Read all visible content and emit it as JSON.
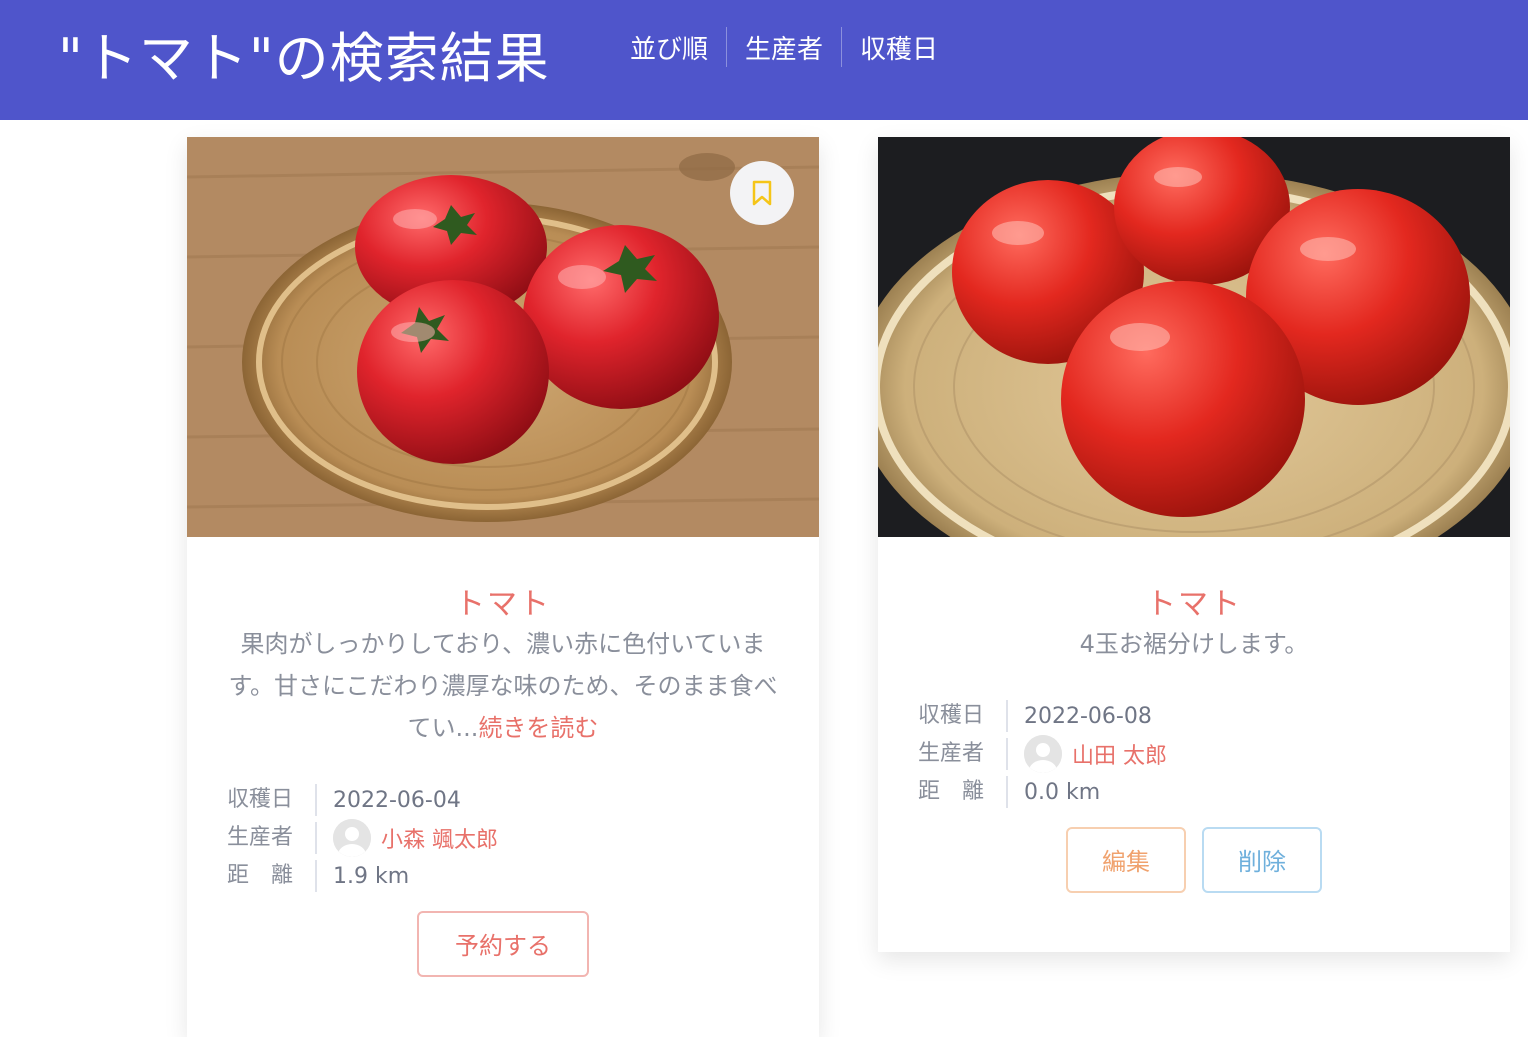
{
  "header": {
    "title": "\"トマト\"の検索結果",
    "sort_label": "並び順",
    "sort_producer": "生産者",
    "sort_harvest": "収穫日"
  },
  "labels": {
    "harvest_date": "収穫日",
    "producer": "生産者",
    "distance": "距　離"
  },
  "cards": [
    {
      "name": "トマト",
      "description": "果肉がしっかりしており、濃い赤に色付いています。甘さにこだわり濃厚な味のため、そのまま食べてい...",
      "read_more": "続きを読む",
      "harvest_date": "2022-06-04",
      "producer": "小森 颯太郎",
      "distance": "1.9 km",
      "reserve_label": "予約する",
      "image_icon": "tomato-photo",
      "bookmark_icon": "bookmark-icon"
    },
    {
      "name": "トマト",
      "description": "4玉お裾分けします。",
      "harvest_date": "2022-06-08",
      "producer": "山田 太郎",
      "distance": "0.0 km",
      "edit_label": "編集",
      "delete_label": "削除",
      "image_icon": "tomato-photo"
    }
  ],
  "colors": {
    "header_bg": "#4f55cb",
    "accent": "#e8716a",
    "edit": "#f0a26e",
    "delete": "#6fb0dc"
  }
}
